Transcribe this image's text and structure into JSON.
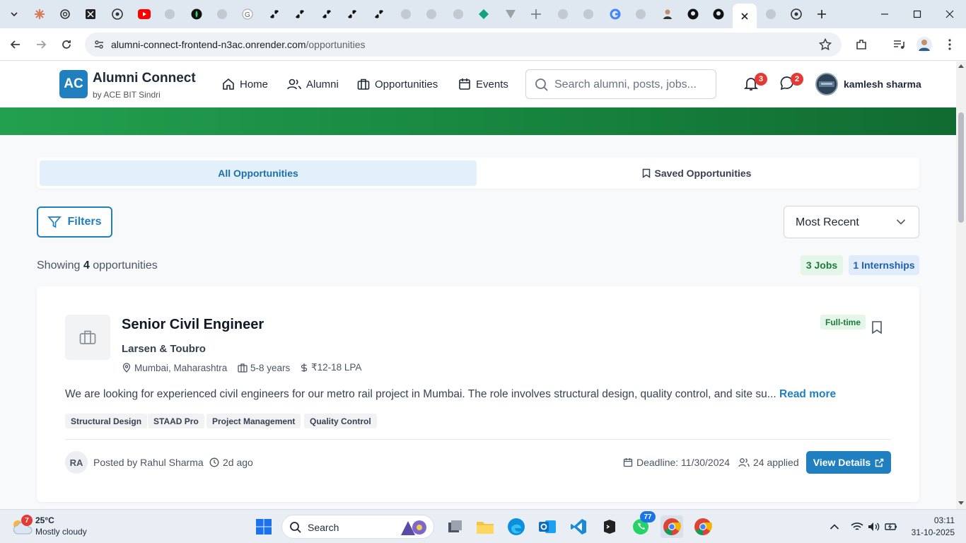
{
  "browser": {
    "url_host": "alumni-connect-frontend-n3ac.onrender.com",
    "url_path": "/opportunities"
  },
  "header": {
    "logo_text": "AC",
    "brand_title": "Alumni Connect",
    "brand_subtitle": "by ACE BIT Sindri",
    "nav": [
      {
        "label": "Home",
        "icon": "home-icon"
      },
      {
        "label": "Alumni",
        "icon": "users-icon"
      },
      {
        "label": "Opportunities",
        "icon": "briefcase-icon"
      },
      {
        "label": "Events",
        "icon": "calendar-icon"
      }
    ],
    "search_placeholder": "Search alumni, posts, jobs...",
    "notifications_count": "3",
    "messages_count": "2",
    "user_name": "kamlesh sharma"
  },
  "tabs": {
    "all": "All Opportunities",
    "saved": "Saved Opportunities"
  },
  "controls": {
    "filters_label": "Filters",
    "sort_value": "Most Recent"
  },
  "summary": {
    "showing_prefix": "Showing",
    "count": "4",
    "showing_suffix": "opportunities",
    "jobs_badge": "3 Jobs",
    "internships_badge": "1 Internships"
  },
  "job": {
    "title": "Senior Civil Engineer",
    "company": "Larsen & Toubro",
    "location": "Mumbai, Maharashtra",
    "experience": "5-8 years",
    "salary": "₹12-18 LPA",
    "type": "Full-time",
    "description": "We are looking for experienced civil engineers for our metro rail project in Mumbai. The role involves structural design, quality control, and site su...",
    "read_more": "Read more",
    "skills": [
      "Structural Design",
      "STAAD Pro",
      "Project Management",
      "Quality Control"
    ],
    "poster_initials": "RA",
    "posted_by": "Posted by Rahul Sharma",
    "posted_ago": "2d ago",
    "deadline": "Deadline: 11/30/2024",
    "applied": "24 applied",
    "view_details": "View Details"
  },
  "taskbar": {
    "weather_badge": "7",
    "temperature": "25°C",
    "weather_desc": "Mostly cloudy",
    "search_label": "Search",
    "whatsapp_badge": "77",
    "time": "03:11",
    "date": "31-10-2025"
  },
  "colors": {
    "primary": "#1f7fbf",
    "banner_green": "#16823d",
    "badge_red": "#e53935"
  }
}
